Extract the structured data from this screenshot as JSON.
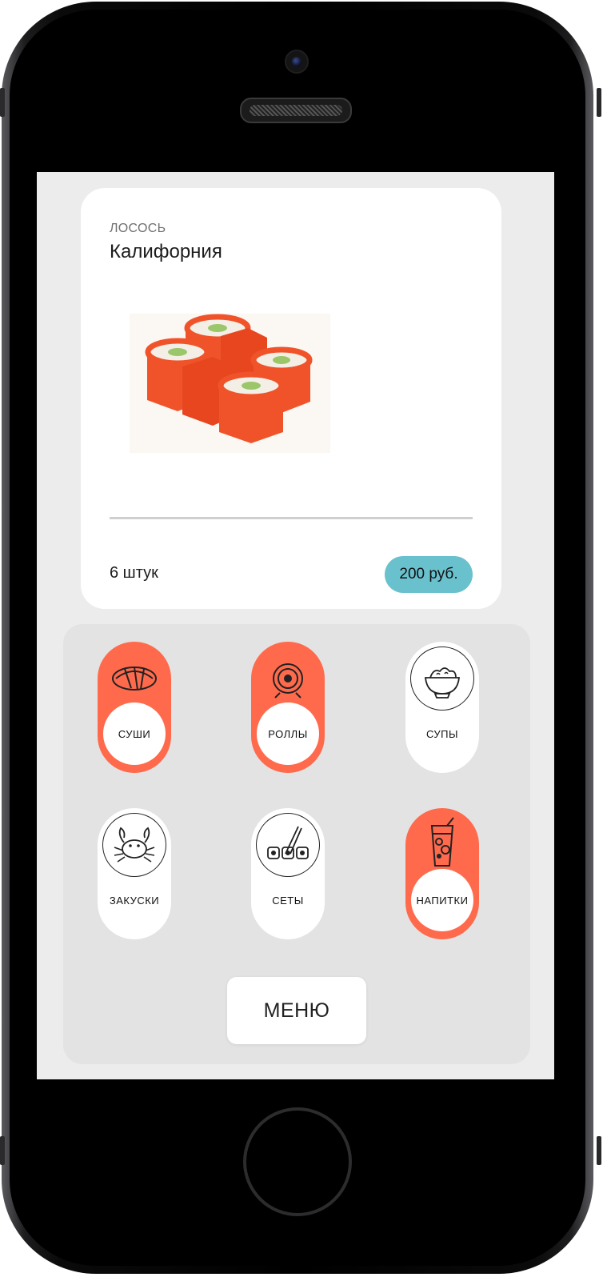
{
  "product": {
    "category": "ЛОСОСЬ",
    "title": "Калифорния",
    "image_icon": "sushi-roll-image",
    "quantity": "6 штук",
    "price": "200 руб."
  },
  "categories": [
    {
      "label": "СУШИ",
      "icon": "sushi-icon",
      "active": true
    },
    {
      "label": "РОЛЛЫ",
      "icon": "roll-icon",
      "active": true
    },
    {
      "label": "СУПЫ",
      "icon": "soup-bowl-icon",
      "active": false
    },
    {
      "label": "ЗАКУСКИ",
      "icon": "crab-icon",
      "active": false
    },
    {
      "label": "СЕТЫ",
      "icon": "set-chopsticks-icon",
      "active": false
    },
    {
      "label": "НАПИТКИ",
      "icon": "drink-glass-icon",
      "active": true
    }
  ],
  "menu_button": "МЕНЮ",
  "colors": {
    "accent": "#ff6a4d",
    "price_badge": "#6ac1ce",
    "screen_bg": "#ececec",
    "panel_bg": "#e3e3e3"
  }
}
